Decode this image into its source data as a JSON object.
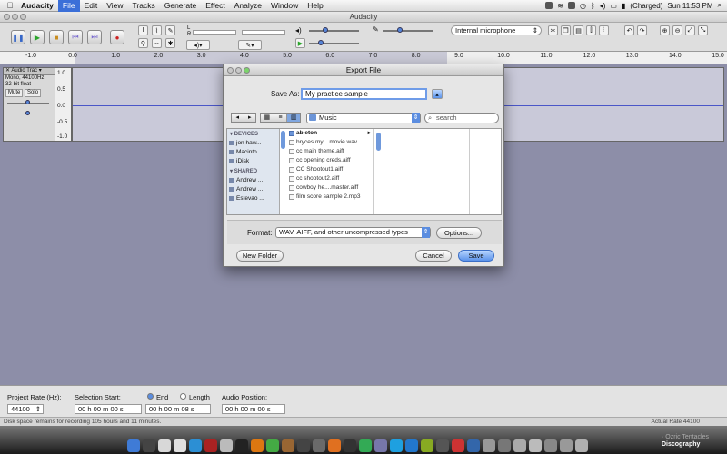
{
  "menubar": {
    "apple": "",
    "items": [
      "Audacity",
      "File",
      "Edit",
      "View",
      "Tracks",
      "Generate",
      "Effect",
      "Analyze",
      "Window",
      "Help"
    ],
    "battery": "(Charged)",
    "clock": "Sun 11:53 PM"
  },
  "window": {
    "title": "Audacity"
  },
  "toolbar": {
    "input_device": "Internal microphone",
    "meter_l": "L",
    "meter_r": "R"
  },
  "ruler": {
    "ticks": [
      "-1.0",
      "0.0",
      "1.0",
      "2.0",
      "3.0",
      "4.0",
      "5.0",
      "6.0",
      "7.0",
      "8.0",
      "9.0",
      "10.0",
      "11.0",
      "12.0",
      "13.0",
      "14.0",
      "15.0"
    ]
  },
  "track": {
    "name": "Audio Trac",
    "info1": "Mono, 44100Hz",
    "info2": "32-bit float",
    "mute": "Mute",
    "solo": "Solo",
    "scale": [
      "1.0",
      "0.5",
      "0.0",
      "-0.5",
      "-1.0"
    ]
  },
  "dialog": {
    "title": "Export File",
    "save_as_label": "Save As:",
    "save_as_value": "My practice sample",
    "location": "Music",
    "search_placeholder": "search",
    "sidebar": {
      "devices_header": "DEVICES",
      "devices": [
        "jon haw...",
        "Macinto...",
        "iDisk"
      ],
      "shared_header": "SHARED",
      "shared": [
        "Andrew ...",
        "Andrew ...",
        "Estevao ..."
      ]
    },
    "files": [
      "ableton",
      "bryces my... movie.wav",
      "cc main theme.aiff",
      "cc opening creds.aiff",
      "CC Shootout1.aiff",
      "cc shootout2.aiff",
      "cowboy he....master.aiff",
      "film score sample 2.mp3"
    ],
    "format_label": "Format:",
    "format_value": "WAV, AIFF, and other uncompressed types",
    "options_button": "Options...",
    "new_folder_button": "New Folder",
    "cancel_button": "Cancel",
    "save_button": "Save"
  },
  "selection": {
    "project_rate_label": "Project Rate (Hz):",
    "project_rate_value": "44100",
    "selection_start_label": "Selection Start:",
    "end_label": "End",
    "length_label": "Length",
    "audio_position_label": "Audio Position:",
    "start_value": "00 h 00 m 00 s",
    "end_value": "00 h 00 m 08 s",
    "position_value": "00 h 00 m 00 s"
  },
  "status": {
    "left": "Disk space remains for recording 105 hours and 11 minutes.",
    "right": "Actual Rate 44100"
  },
  "overlay": {
    "line1": "· Ozric Tentacles",
    "line2": "Discography"
  }
}
